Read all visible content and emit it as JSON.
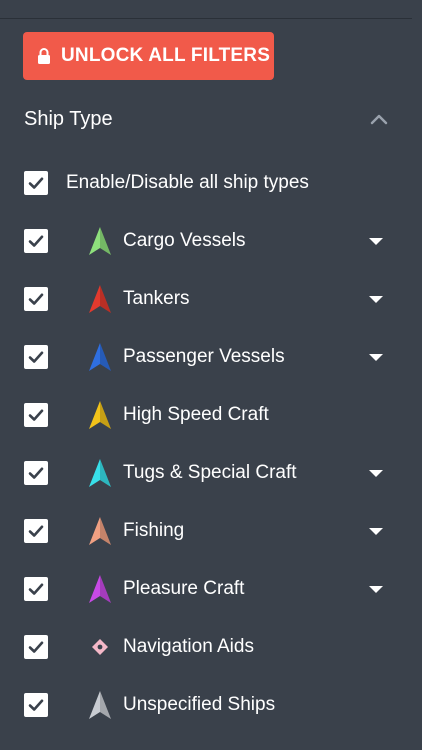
{
  "unlock_button": {
    "label": "UNLOCK ALL FILTERS",
    "color": "#f15a4a"
  },
  "section": {
    "title": "Ship Type",
    "expanded": true
  },
  "enable_all": {
    "label": "Enable/Disable all ship types",
    "checked": true
  },
  "ship_types": [
    {
      "label": "Cargo Vessels",
      "checked": true,
      "icon_color": "#8ee07c",
      "has_dropdown": true,
      "icon": "arrow-icon"
    },
    {
      "label": "Tankers",
      "checked": true,
      "icon_color": "#e23a2e",
      "has_dropdown": true,
      "icon": "arrow-icon"
    },
    {
      "label": "Passenger Vessels",
      "checked": true,
      "icon_color": "#2f6fe0",
      "has_dropdown": true,
      "icon": "arrow-icon"
    },
    {
      "label": "High Speed Craft",
      "checked": true,
      "icon_color": "#f2c31a",
      "has_dropdown": false,
      "icon": "arrow-icon"
    },
    {
      "label": "Tugs & Special Craft",
      "checked": true,
      "icon_color": "#38e0ea",
      "has_dropdown": true,
      "icon": "arrow-icon"
    },
    {
      "label": "Fishing",
      "checked": true,
      "icon_color": "#f0a082",
      "has_dropdown": true,
      "icon": "arrow-icon"
    },
    {
      "label": "Pleasure Craft",
      "checked": true,
      "icon_color": "#c84ae6",
      "has_dropdown": true,
      "icon": "arrow-icon"
    },
    {
      "label": "Navigation Aids",
      "checked": true,
      "icon_color": "#f4b8c8",
      "has_dropdown": false,
      "icon": "diamond-icon"
    },
    {
      "label": "Unspecified Ships",
      "checked": true,
      "icon_color": "#c8ccd2",
      "has_dropdown": false,
      "icon": "arrow-icon"
    }
  ]
}
